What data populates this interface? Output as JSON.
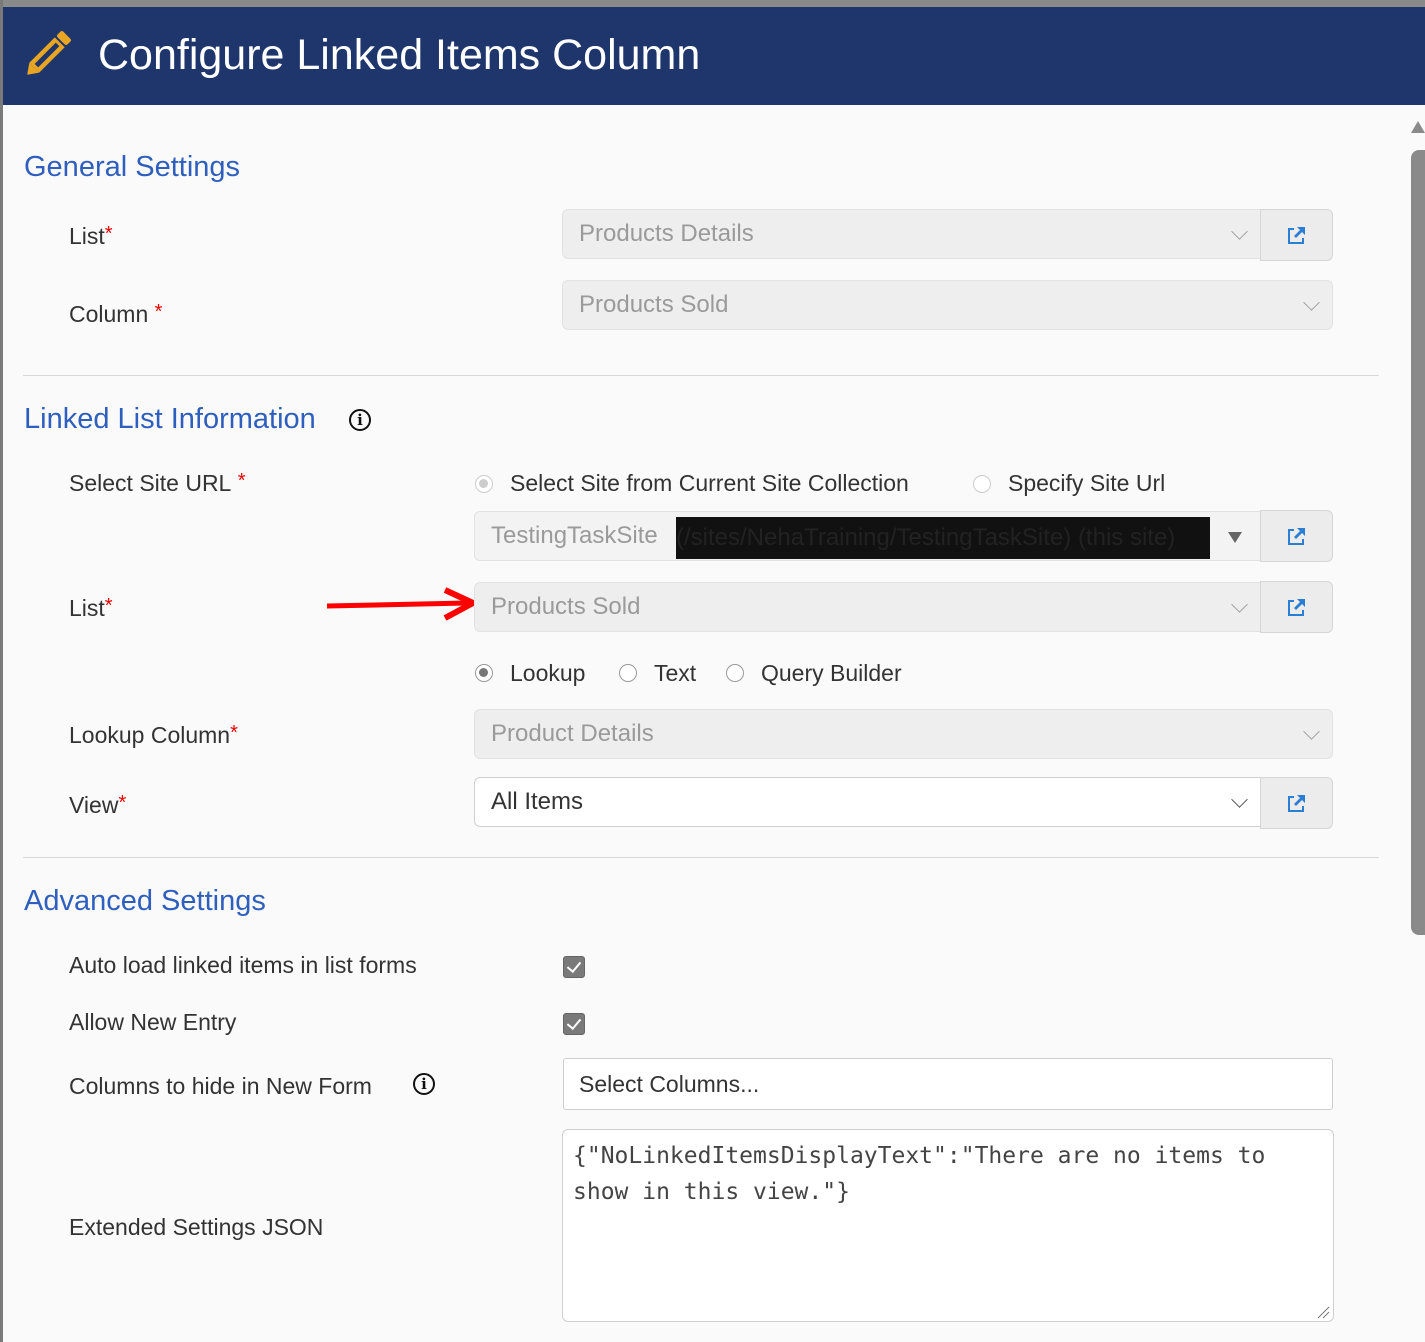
{
  "header": {
    "title": "Configure Linked Items Column",
    "icon": "pencil-icon",
    "icon_color": "#e8a623",
    "background": "#1f366d"
  },
  "general": {
    "title": "General Settings",
    "list_label": "List",
    "list_value": "Products Details",
    "column_label": "Column",
    "column_value": "Products Sold"
  },
  "linked": {
    "title": "Linked List Information",
    "site_url_label": "Select Site URL",
    "site_options": [
      {
        "label": "Select Site from Current Site Collection",
        "selected": true
      },
      {
        "label": "Specify Site Url",
        "selected": false
      }
    ],
    "site_value": "TestingTaskSite",
    "site_value_redacted": "(/sites/NehaTraining/TestingTaskSite) (this site)",
    "list_label": "List",
    "list_value": "Products Sold",
    "type_options": [
      {
        "label": "Lookup",
        "selected": true
      },
      {
        "label": "Text",
        "selected": false
      },
      {
        "label": "Query Builder",
        "selected": false
      }
    ],
    "lookup_label": "Lookup Column",
    "lookup_value": "Product Details",
    "view_label": "View",
    "view_value": "All Items"
  },
  "advanced": {
    "title": "Advanced Settings",
    "autoload_label": "Auto load linked items in list forms",
    "autoload_checked": true,
    "allow_new_label": "Allow New Entry",
    "allow_new_checked": true,
    "hide_cols_label": "Columns to hide in New Form",
    "hide_cols_placeholder": "Select Columns...",
    "ext_json_label": "Extended Settings JSON",
    "ext_json_value": "{\"NoLinkedItemsDisplayText\":\"There are no items to show in this view.\"}"
  },
  "required_mark": "*",
  "info_glyph": "i",
  "colors": {
    "section_title": "#2f5fbe",
    "required": "#ee0000",
    "annotation_arrow": "#ff0000",
    "link_icon": "#2a7fd4"
  }
}
